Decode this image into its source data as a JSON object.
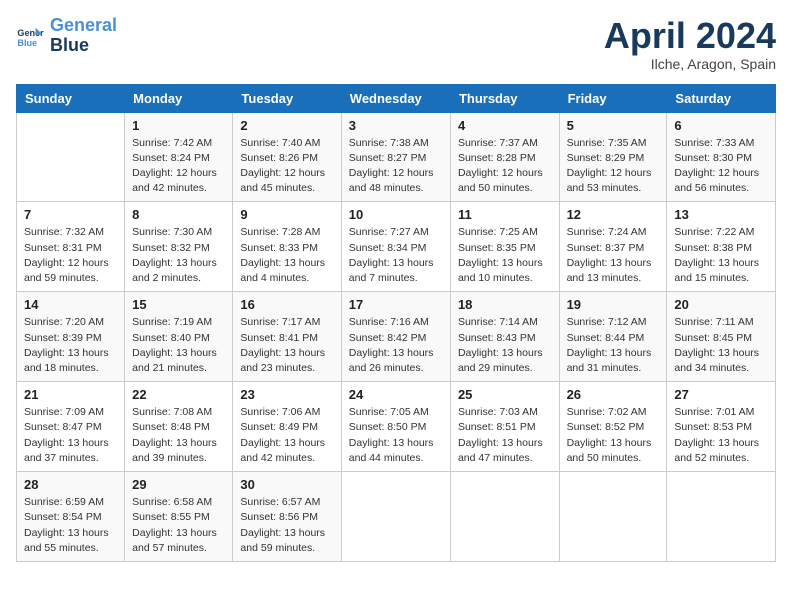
{
  "logo": {
    "line1": "General",
    "line2": "Blue"
  },
  "title": "April 2024",
  "subtitle": "Ilche, Aragon, Spain",
  "weekdays": [
    "Sunday",
    "Monday",
    "Tuesday",
    "Wednesday",
    "Thursday",
    "Friday",
    "Saturday"
  ],
  "weeks": [
    [
      {
        "day": "",
        "info": ""
      },
      {
        "day": "1",
        "info": "Sunrise: 7:42 AM\nSunset: 8:24 PM\nDaylight: 12 hours\nand 42 minutes."
      },
      {
        "day": "2",
        "info": "Sunrise: 7:40 AM\nSunset: 8:26 PM\nDaylight: 12 hours\nand 45 minutes."
      },
      {
        "day": "3",
        "info": "Sunrise: 7:38 AM\nSunset: 8:27 PM\nDaylight: 12 hours\nand 48 minutes."
      },
      {
        "day": "4",
        "info": "Sunrise: 7:37 AM\nSunset: 8:28 PM\nDaylight: 12 hours\nand 50 minutes."
      },
      {
        "day": "5",
        "info": "Sunrise: 7:35 AM\nSunset: 8:29 PM\nDaylight: 12 hours\nand 53 minutes."
      },
      {
        "day": "6",
        "info": "Sunrise: 7:33 AM\nSunset: 8:30 PM\nDaylight: 12 hours\nand 56 minutes."
      }
    ],
    [
      {
        "day": "7",
        "info": "Sunrise: 7:32 AM\nSunset: 8:31 PM\nDaylight: 12 hours\nand 59 minutes."
      },
      {
        "day": "8",
        "info": "Sunrise: 7:30 AM\nSunset: 8:32 PM\nDaylight: 13 hours\nand 2 minutes."
      },
      {
        "day": "9",
        "info": "Sunrise: 7:28 AM\nSunset: 8:33 PM\nDaylight: 13 hours\nand 4 minutes."
      },
      {
        "day": "10",
        "info": "Sunrise: 7:27 AM\nSunset: 8:34 PM\nDaylight: 13 hours\nand 7 minutes."
      },
      {
        "day": "11",
        "info": "Sunrise: 7:25 AM\nSunset: 8:35 PM\nDaylight: 13 hours\nand 10 minutes."
      },
      {
        "day": "12",
        "info": "Sunrise: 7:24 AM\nSunset: 8:37 PM\nDaylight: 13 hours\nand 13 minutes."
      },
      {
        "day": "13",
        "info": "Sunrise: 7:22 AM\nSunset: 8:38 PM\nDaylight: 13 hours\nand 15 minutes."
      }
    ],
    [
      {
        "day": "14",
        "info": "Sunrise: 7:20 AM\nSunset: 8:39 PM\nDaylight: 13 hours\nand 18 minutes."
      },
      {
        "day": "15",
        "info": "Sunrise: 7:19 AM\nSunset: 8:40 PM\nDaylight: 13 hours\nand 21 minutes."
      },
      {
        "day": "16",
        "info": "Sunrise: 7:17 AM\nSunset: 8:41 PM\nDaylight: 13 hours\nand 23 minutes."
      },
      {
        "day": "17",
        "info": "Sunrise: 7:16 AM\nSunset: 8:42 PM\nDaylight: 13 hours\nand 26 minutes."
      },
      {
        "day": "18",
        "info": "Sunrise: 7:14 AM\nSunset: 8:43 PM\nDaylight: 13 hours\nand 29 minutes."
      },
      {
        "day": "19",
        "info": "Sunrise: 7:12 AM\nSunset: 8:44 PM\nDaylight: 13 hours\nand 31 minutes."
      },
      {
        "day": "20",
        "info": "Sunrise: 7:11 AM\nSunset: 8:45 PM\nDaylight: 13 hours\nand 34 minutes."
      }
    ],
    [
      {
        "day": "21",
        "info": "Sunrise: 7:09 AM\nSunset: 8:47 PM\nDaylight: 13 hours\nand 37 minutes."
      },
      {
        "day": "22",
        "info": "Sunrise: 7:08 AM\nSunset: 8:48 PM\nDaylight: 13 hours\nand 39 minutes."
      },
      {
        "day": "23",
        "info": "Sunrise: 7:06 AM\nSunset: 8:49 PM\nDaylight: 13 hours\nand 42 minutes."
      },
      {
        "day": "24",
        "info": "Sunrise: 7:05 AM\nSunset: 8:50 PM\nDaylight: 13 hours\nand 44 minutes."
      },
      {
        "day": "25",
        "info": "Sunrise: 7:03 AM\nSunset: 8:51 PM\nDaylight: 13 hours\nand 47 minutes."
      },
      {
        "day": "26",
        "info": "Sunrise: 7:02 AM\nSunset: 8:52 PM\nDaylight: 13 hours\nand 50 minutes."
      },
      {
        "day": "27",
        "info": "Sunrise: 7:01 AM\nSunset: 8:53 PM\nDaylight: 13 hours\nand 52 minutes."
      }
    ],
    [
      {
        "day": "28",
        "info": "Sunrise: 6:59 AM\nSunset: 8:54 PM\nDaylight: 13 hours\nand 55 minutes."
      },
      {
        "day": "29",
        "info": "Sunrise: 6:58 AM\nSunset: 8:55 PM\nDaylight: 13 hours\nand 57 minutes."
      },
      {
        "day": "30",
        "info": "Sunrise: 6:57 AM\nSunset: 8:56 PM\nDaylight: 13 hours\nand 59 minutes."
      },
      {
        "day": "",
        "info": ""
      },
      {
        "day": "",
        "info": ""
      },
      {
        "day": "",
        "info": ""
      },
      {
        "day": "",
        "info": ""
      }
    ]
  ]
}
